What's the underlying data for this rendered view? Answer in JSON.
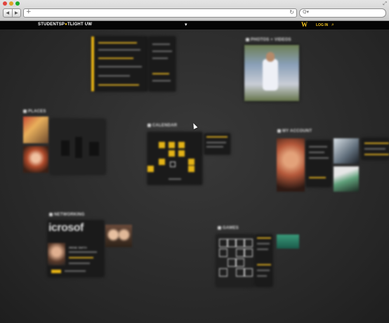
{
  "browser": {
    "url_placeholder": "+",
    "reload_icon": "↻",
    "search_icon": "Q▾",
    "back_icon": "◀",
    "forward_icon": "▶",
    "resize_icon": "⤢",
    "traffic_lights": [
      "#e0443e",
      "#dea123",
      "#1aab29"
    ]
  },
  "site": {
    "logo_prefix": "STUDENTSP",
    "logo_accent": "●",
    "logo_suffix": "TLIGHT UW",
    "menu_icon": "▾",
    "w_mark": "W",
    "login": "LOG IN",
    "search_icon": "⌕",
    "accent_color": "#f2c21b"
  },
  "tiles": {
    "places": "PLACES",
    "photos": "PHOTOS + VIDEOS",
    "calendar": "CALENDAR",
    "account": "MY ACCOUNT",
    "networking": "NETWORKING",
    "games": "GAMES"
  },
  "networking": {
    "logo_text": "icrosof",
    "name": "IRENE SMITH"
  }
}
